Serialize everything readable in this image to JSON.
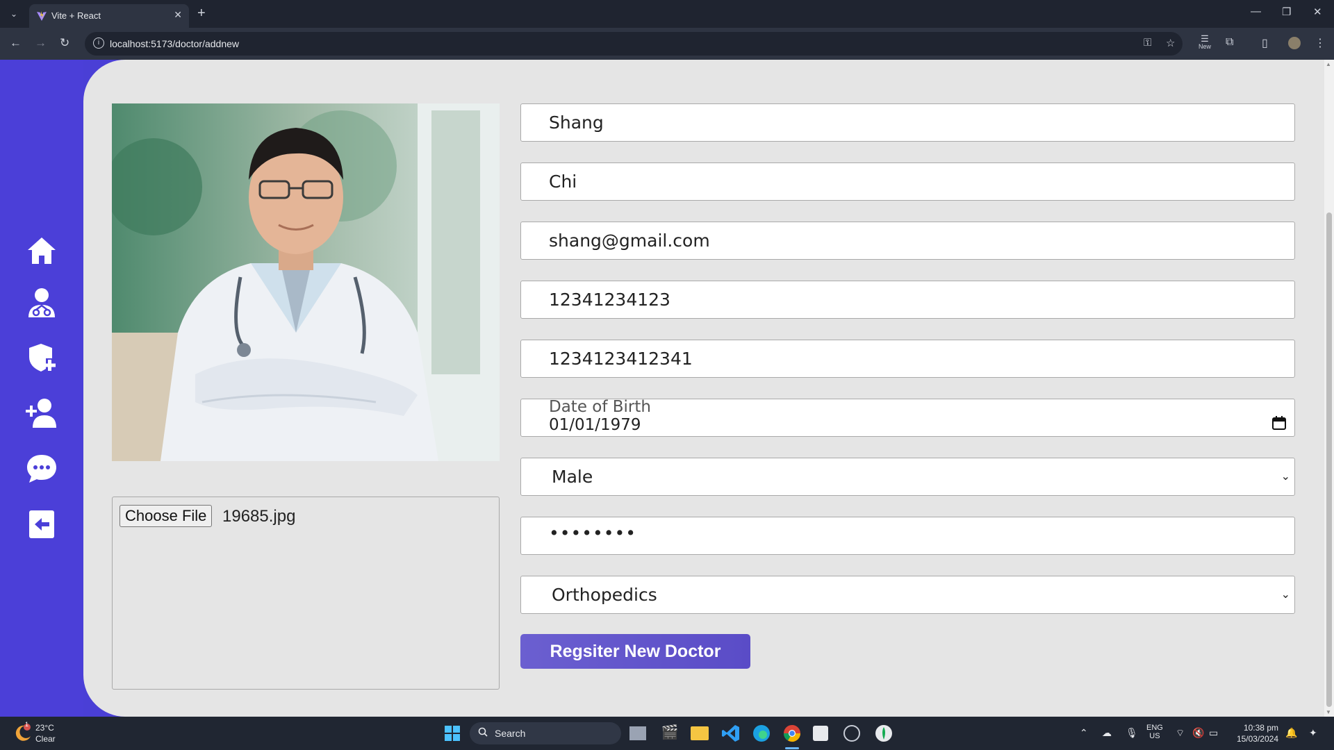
{
  "browser": {
    "tab_title": "Vite + React",
    "url": "localhost:5173/doctor/addnew",
    "extension_badge": "New"
  },
  "sidebar": {
    "items": [
      {
        "icon": "home-icon"
      },
      {
        "icon": "doctor-icon"
      },
      {
        "icon": "shield-plus-icon"
      },
      {
        "icon": "add-user-icon"
      },
      {
        "icon": "chat-icon"
      },
      {
        "icon": "logout-icon"
      }
    ],
    "accent": "#4b3fd8"
  },
  "form": {
    "first_name": "Shang",
    "last_name": "Chi",
    "email": "shang@gmail.com",
    "phone": "12341234123",
    "nic": "1234123412341",
    "dob_label": "Date of Birth",
    "dob_value": "01/01/1979",
    "gender": "Male",
    "password": "••••••••",
    "department": "Orthopedics",
    "submit_label": "Regsiter New Doctor"
  },
  "file_input": {
    "button_label": "Choose File",
    "file_name": "19685.jpg"
  },
  "taskbar": {
    "weather_temp": "23°C",
    "weather_desc": "Clear",
    "weather_badge": "1",
    "search_placeholder": "Search",
    "lang_line1": "ENG",
    "lang_line2": "US",
    "time": "10:38 pm",
    "date": "15/03/2024"
  }
}
